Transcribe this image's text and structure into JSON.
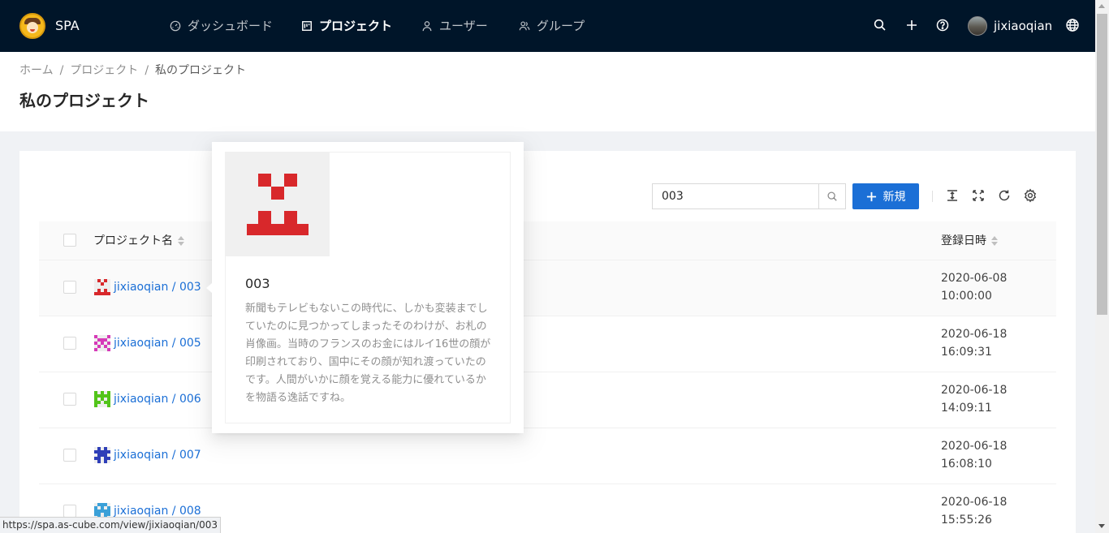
{
  "header": {
    "app_title": "SPA",
    "nav": [
      {
        "label": "ダッシュボード",
        "icon": "dashboard-icon"
      },
      {
        "label": "プロジェクト",
        "icon": "project-icon",
        "active": true
      },
      {
        "label": "ユーザー",
        "icon": "user-icon"
      },
      {
        "label": "グループ",
        "icon": "group-icon"
      }
    ],
    "username": "jixiaoqian",
    "icons": [
      "search-icon",
      "plus-icon",
      "help-icon",
      "globe-icon"
    ]
  },
  "breadcrumb": [
    "ホーム",
    "プロジェクト",
    "私のプロジェクト"
  ],
  "page_title": "私のプロジェクト",
  "toolbar": {
    "search_value": "003",
    "new_label": "新規",
    "tools": [
      "column-height-icon",
      "fullscreen-icon",
      "reload-icon",
      "setting-icon"
    ]
  },
  "table": {
    "columns": [
      "プロジェクト名",
      "登録日時"
    ],
    "rows": [
      {
        "name": "jixiaoqian / 003",
        "date": "2020-06-08",
        "time": "10:00:00",
        "color": "#d8282b"
      },
      {
        "name": "jixiaoqian / 005",
        "date": "2020-06-18",
        "time": "16:09:31",
        "color": "#d63ab8"
      },
      {
        "name": "jixiaoqian / 006",
        "date": "2020-06-18",
        "time": "14:09:11",
        "color": "#52c41a"
      },
      {
        "name": "jixiaoqian / 007",
        "date": "2020-06-18",
        "time": "16:08:10",
        "color": "#2f3fb8"
      },
      {
        "name": "jixiaoqian / 008",
        "date": "2020-06-18",
        "time": "15:55:26",
        "color": "#3aa0d8"
      }
    ]
  },
  "popover": {
    "title": "003",
    "description": "新聞もテレビもないこの時代に、しかも変装までしていたのに見つかってしまったそのわけが、お札の肖像画。当時のフランスのお金にはルイ16世の顔が印刷されており、国中にその顔が知れ渡っていたのです。人間がいかに顔を覚える能力に優れているかを物語る逸話ですね。"
  },
  "status_url": "https://spa.as-cube.com/view/jixiaoqian/003"
}
